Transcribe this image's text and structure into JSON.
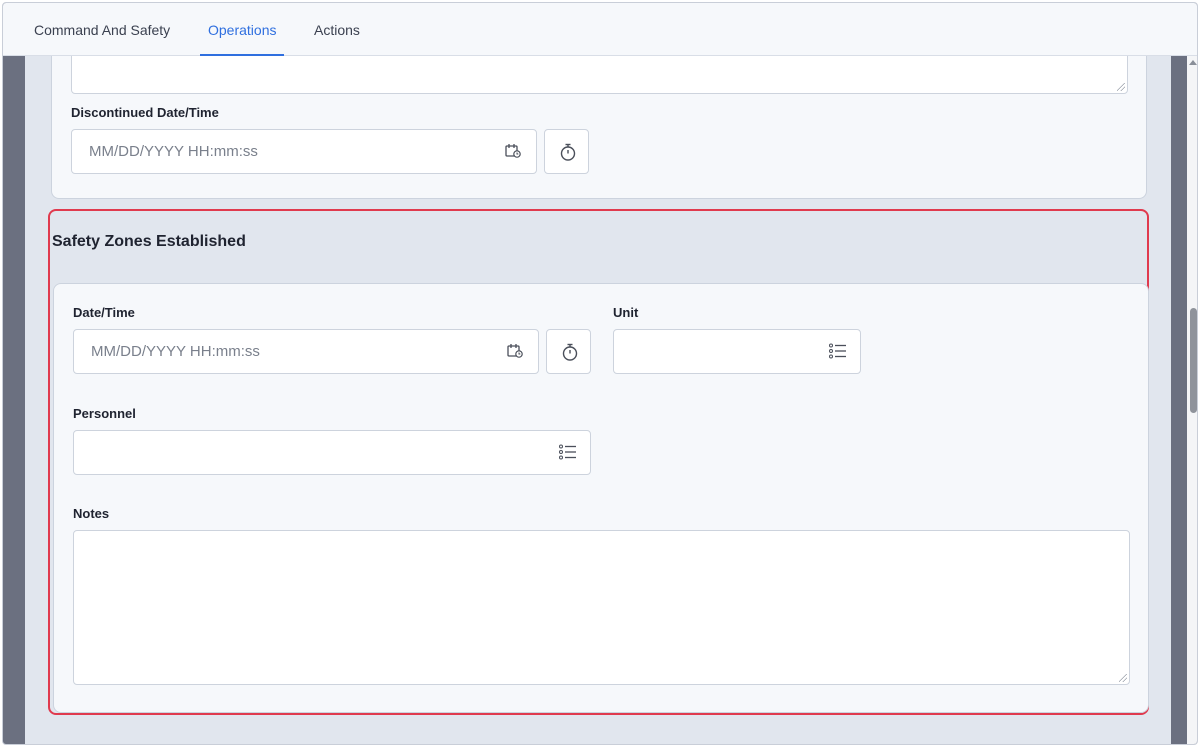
{
  "tabs": [
    {
      "label": "Command And Safety"
    },
    {
      "label": "Operations"
    },
    {
      "label": "Actions"
    }
  ],
  "active_tab": "Operations",
  "discontinued": {
    "label": "Discontinued Date/Time",
    "placeholder": "MM/DD/YYYY HH:mm:ss"
  },
  "safety_section": {
    "title": "Safety Zones Established",
    "datetime_label": "Date/Time",
    "datetime_placeholder": "MM/DD/YYYY HH:mm:ss",
    "unit_label": "Unit",
    "personnel_label": "Personnel",
    "notes_label": "Notes"
  },
  "colors": {
    "accent": "#2f6fdf",
    "highlight_border": "#e03a4e"
  },
  "icons": [
    "calendar-clock-icon",
    "stopwatch-icon",
    "list-icon"
  ]
}
